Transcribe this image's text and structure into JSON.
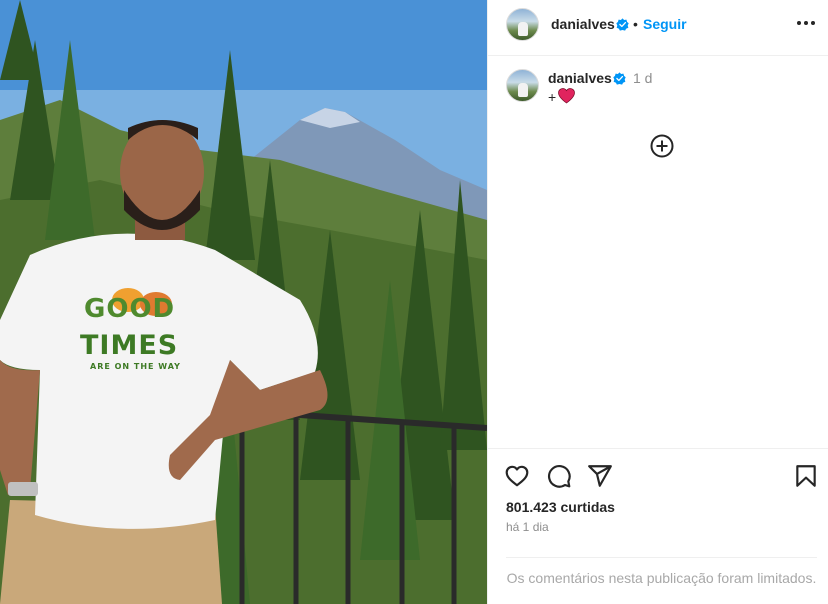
{
  "header": {
    "username": "danialves",
    "separator": "•",
    "follow_label": "Seguir",
    "more_icon": "more-horizontal-icon"
  },
  "caption": {
    "username": "danialves",
    "time": "1 d",
    "text": "+",
    "emoji": "red-heart"
  },
  "photo": {
    "shirt_text_1": "GOOD",
    "shirt_text_2": "TIMES",
    "shirt_text_3": "ARE ON THE WAY"
  },
  "actions": {
    "icons": [
      "heart-icon",
      "comment-icon",
      "share-icon",
      "save-icon"
    ],
    "likes": "801.423 curtidas",
    "date": "há 1 dia",
    "comments_disabled": "Os comentários nesta publicação foram limitados."
  },
  "colors": {
    "accent": "#0095f6",
    "verified": "#0095f6",
    "heart": "#e0245e"
  }
}
